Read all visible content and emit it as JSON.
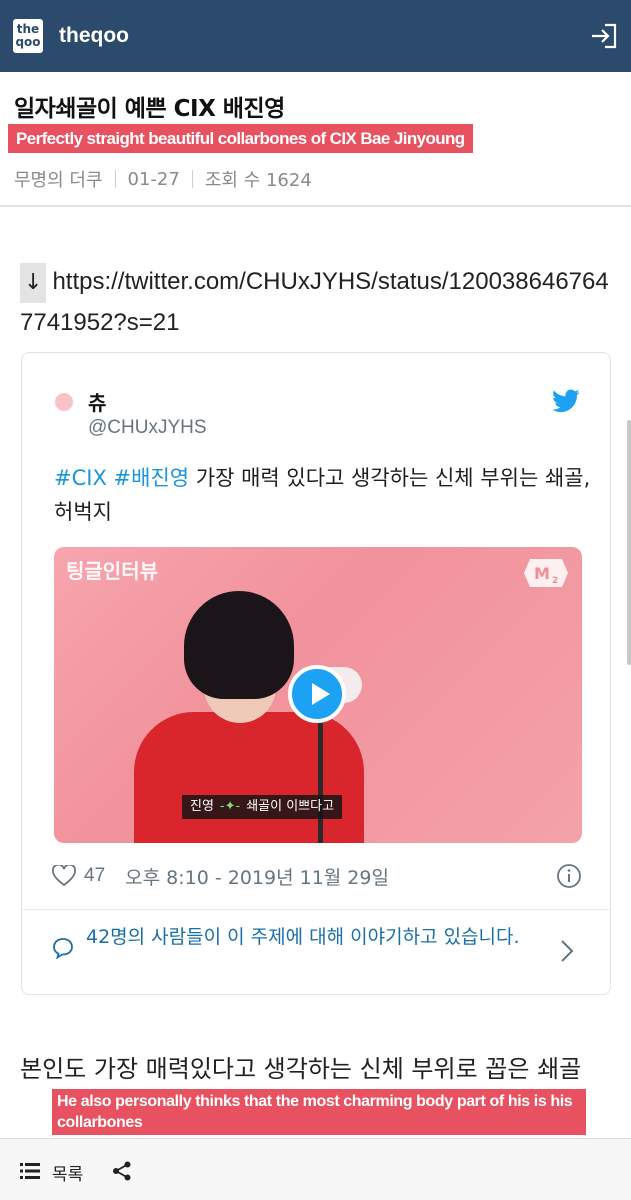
{
  "header": {
    "logo_top": "the",
    "logo_bottom": "qoo",
    "site_name": "theqoo"
  },
  "post": {
    "title": "일자쇄골이 예쁜 CIX 배진영",
    "title_translation": "Perfectly straight beautiful collarbones of CIX Bae Jinyoung",
    "author": "무명의 더쿠",
    "date": "01-27",
    "views": "조회 수 1624",
    "arrow": "↓",
    "link": "https://twitter.com/CHUxJYHS/status/1200386467647741952?s=21",
    "body_text": "본인도 가장 매력있다고 생각하는 신체 부위로 꼽은 쇄골",
    "body_translation": "He also personally thinks that the most charming body part of his is his collarbones"
  },
  "tweet": {
    "name": "츄",
    "handle": "@CHUxJYHS",
    "tag1": "#CIX",
    "tag2": "#배진영",
    "text": " 가장 매력 있다고 생각하는 신체 부위는 쇄골, 허벅지",
    "video_overlay": "팅글인터뷰",
    "subtitle_name": "진영",
    "subtitle_wave": "-✦-",
    "subtitle_text": "쇄골이 이쁘다고",
    "likes": "47",
    "timestamp": "오후 8:10 - 2019년 11월 29일",
    "talk": "42명의 사람들이 이 주제에 대해 이야기하고 있습니다."
  },
  "bottom_bar": {
    "list_label": "목록"
  },
  "colors": {
    "header_bg": "#2b4a6c",
    "highlight": "#e75160",
    "twitter_blue": "#1da1f2",
    "link_blue": "#1b6fa8"
  }
}
